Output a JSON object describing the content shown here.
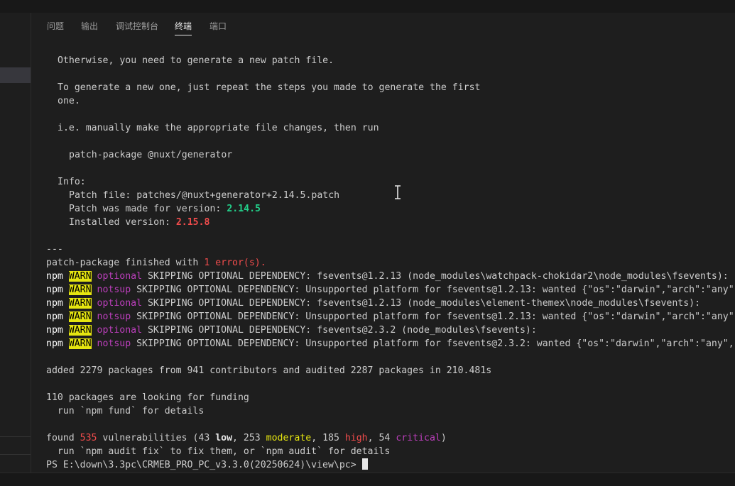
{
  "panel": {
    "tabs": [
      {
        "label": "问题"
      },
      {
        "label": "输出"
      },
      {
        "label": "调试控制台"
      },
      {
        "label": "终端"
      },
      {
        "label": "端口"
      }
    ]
  },
  "terminal": {
    "l1": "Otherwise, you need to generate a new patch file.",
    "l2": "To generate a new one, just repeat the steps you made to generate the first",
    "l3": "one.",
    "l4": "i.e. manually make the appropriate file changes, then run",
    "l5": "patch-package @nuxt/generator",
    "l6": "Info:",
    "l7": "Patch file: patches/@nuxt+generator+2.14.5.patch",
    "l8a": "Patch was made for version: ",
    "l8b": "2.14.5",
    "l9a": "Installed version: ",
    "l9b": "2.15.8",
    "l10": "---",
    "l11a": "patch-package finished with ",
    "l11b": "1 error(s).",
    "npm": "npm",
    "warn": "WARN",
    "optional": "optional",
    "notsup": "notsup",
    "w1": " SKIPPING OPTIONAL DEPENDENCY: fsevents@1.2.13 (node_modules\\watchpack-chokidar2\\node_modules\\fsevents):",
    "w2": " SKIPPING OPTIONAL DEPENDENCY: Unsupported platform for fsevents@1.2.13: wanted {\"os\":\"darwin\",\"arch\":\"any\"",
    "w3": " SKIPPING OPTIONAL DEPENDENCY: fsevents@1.2.13 (node_modules\\element-themex\\node_modules\\fsevents):",
    "w4": " SKIPPING OPTIONAL DEPENDENCY: Unsupported platform for fsevents@1.2.13: wanted {\"os\":\"darwin\",\"arch\":\"any\"",
    "w5": " SKIPPING OPTIONAL DEPENDENCY: fsevents@2.3.2 (node_modules\\fsevents):",
    "w6": " SKIPPING OPTIONAL DEPENDENCY: Unsupported platform for fsevents@2.3.2: wanted {\"os\":\"darwin\",\"arch\":\"any\",",
    "added": "added 2279 packages from 941 contributors and audited 2287 packages in 210.481s",
    "funding1": "110 packages are looking for funding",
    "funding2": "  run `npm fund` for details",
    "vuln_a": "found ",
    "vuln_n": "535",
    "vuln_b": " vulnerabilities (43 ",
    "vuln_low": "low",
    "vuln_c": ", 253 ",
    "vuln_mod": "moderate",
    "vuln_d": ", 185 ",
    "vuln_high": "high",
    "vuln_e": ", 54 ",
    "vuln_crit": "critical",
    "vuln_f": ")",
    "audit": "  run `npm audit fix` to fix them, or `npm audit` for details",
    "prompt": "PS E:\\down\\3.3pc\\CRMEB_PRO_PC_v3.3.0(20250624)\\view\\pc> "
  },
  "colors": {
    "warn_bg": "#e5e510",
    "magenta": "#bc3fbc",
    "green": "#23d18b",
    "red": "#f14c4c"
  }
}
